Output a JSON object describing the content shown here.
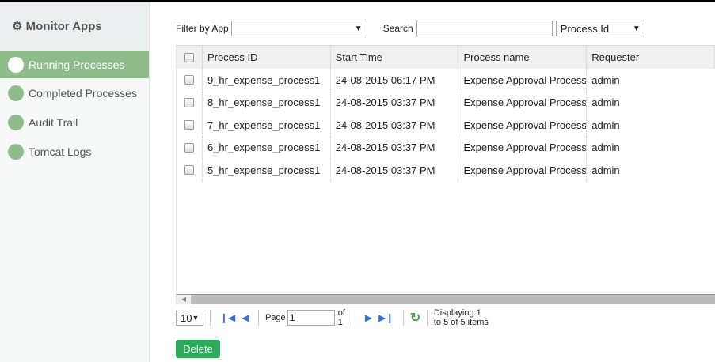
{
  "sidebar": {
    "title": "Monitor Apps",
    "icon": "dashboard-icon",
    "items": [
      {
        "label": "Running Processes",
        "active": true
      },
      {
        "label": "Completed Processes"
      },
      {
        "label": "Audit Trail"
      },
      {
        "label": "Tomcat Logs"
      }
    ]
  },
  "filters": {
    "filter_label": "Filter by App",
    "filter_value": "",
    "search_label": "Search",
    "search_value": "",
    "search_field": "Process Id"
  },
  "grid": {
    "columns": [
      "Process ID",
      "Start Time",
      "Process name",
      "Requester"
    ],
    "rows": [
      [
        "9_hr_expense_process1",
        "24-08-2015 06:17 PM",
        "Expense Approval Process",
        "admin"
      ],
      [
        "8_hr_expense_process1",
        "24-08-2015 03:37 PM",
        "Expense Approval Process",
        "admin"
      ],
      [
        "7_hr_expense_process1",
        "24-08-2015 03:37 PM",
        "Expense Approval Process",
        "admin"
      ],
      [
        "6_hr_expense_process1",
        "24-08-2015 03:37 PM",
        "Expense Approval Process",
        "admin"
      ],
      [
        "5_hr_expense_process1",
        "24-08-2015 03:37 PM",
        "Expense Approval Process",
        "admin"
      ]
    ]
  },
  "pager": {
    "page_size": "10",
    "page_label": "Page",
    "page": "1",
    "of_label": "of 1",
    "status": "Displaying 1 to 5 of 5 items"
  },
  "actions": {
    "delete": "Delete"
  },
  "colors": {
    "accent": "#8fbc8b",
    "delete": "#2eaa5c"
  }
}
